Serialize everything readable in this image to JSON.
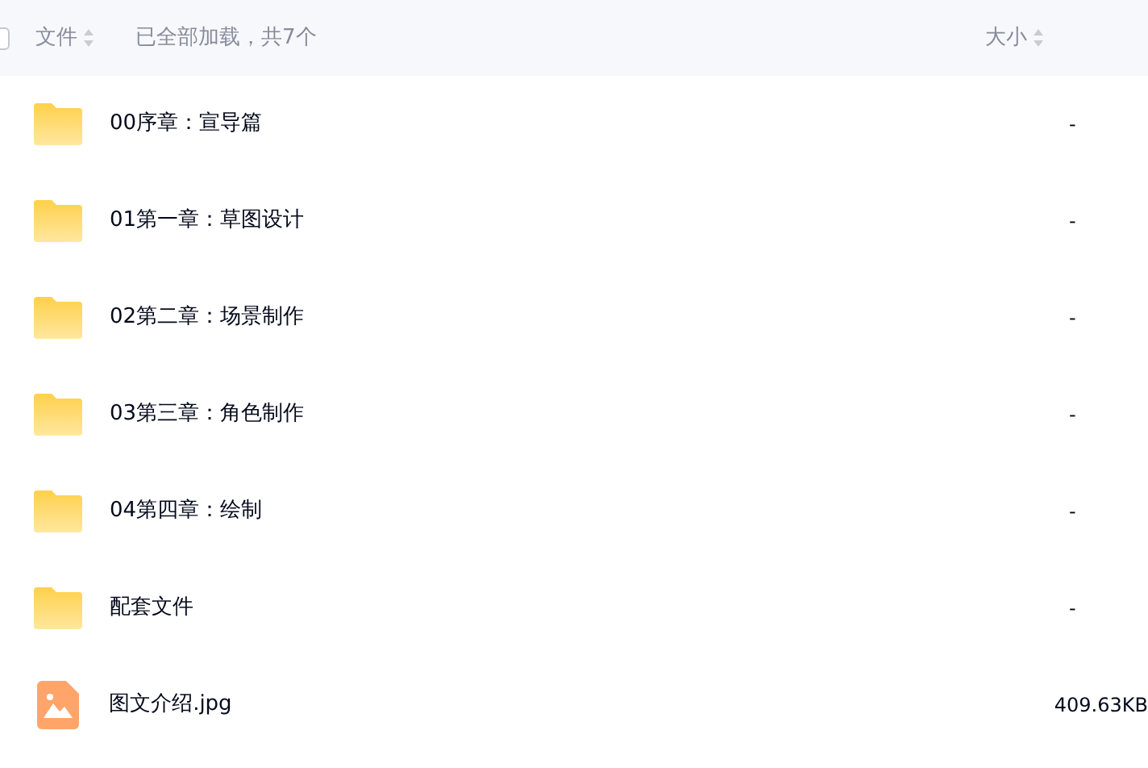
{
  "header": {
    "select_all": {
      "checked": false
    },
    "name_column": "文件",
    "summary": "已全部加载，共7个",
    "size_column": "大小"
  },
  "files": [
    {
      "kind": "folder",
      "name": "00序章：宣导篇",
      "size": "-"
    },
    {
      "kind": "folder",
      "name": "01第一章：草图设计",
      "size": "-"
    },
    {
      "kind": "folder",
      "name": "02第二章：场景制作",
      "size": "-"
    },
    {
      "kind": "folder",
      "name": "03第三章：角色制作",
      "size": "-"
    },
    {
      "kind": "folder",
      "name": "04第四章：绘制",
      "size": "-"
    },
    {
      "kind": "folder",
      "name": "配套文件",
      "size": "-"
    },
    {
      "kind": "image",
      "name": "图文介绍.jpg",
      "size": "409.63KB"
    }
  ]
}
